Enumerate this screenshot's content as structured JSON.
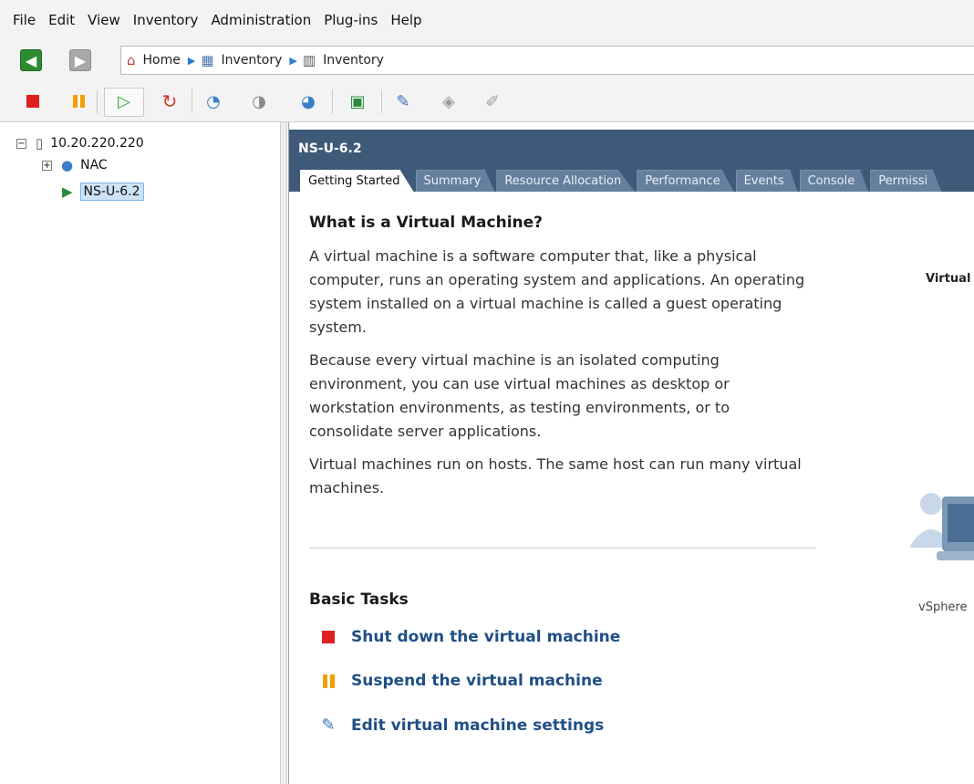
{
  "menu": [
    "File",
    "Edit",
    "View",
    "Inventory",
    "Administration",
    "Plug-ins",
    "Help"
  ],
  "breadcrumb": {
    "home": "Home",
    "crumbs": [
      "Inventory",
      "Inventory"
    ]
  },
  "tree": {
    "host": "10.20.220.220",
    "folder": "NAC",
    "vm": "NS-U-6.2",
    "host_expander": "−",
    "folder_expander": "+"
  },
  "vm_header": {
    "title": "NS-U-6.2",
    "tabs": [
      "Getting Started",
      "Summary",
      "Resource Allocation",
      "Performance",
      "Events",
      "Console",
      "Permissi"
    ]
  },
  "getting_started": {
    "heading": "What is a Virtual Machine?",
    "paragraphs": [
      "A virtual machine is a software computer that, like a physical computer, runs an operating system and applications. An operating system installed on a virtual machine is called a guest operating system.",
      "Because every virtual machine is an isolated computing environment, you can use virtual machines as desktop or workstation environments, as testing environments, or to consolidate server applications.",
      "Virtual machines run on hosts. The same host can run many virtual machines."
    ],
    "side_label_top": "Virtual",
    "side_label_bottom": "vSphere"
  },
  "basic_tasks": {
    "title": "Basic Tasks",
    "items": [
      {
        "label": "Shut down the virtual machine",
        "icon": "stop-icon"
      },
      {
        "label": "Suspend the virtual machine",
        "icon": "pause-icon"
      },
      {
        "label": "Edit virtual machine settings",
        "icon": "edit-settings-icon"
      }
    ]
  },
  "colors": {
    "header_bg": "#3f5a78",
    "link": "#1f4f86",
    "stop": "#e02020",
    "pause": "#f0a000"
  }
}
